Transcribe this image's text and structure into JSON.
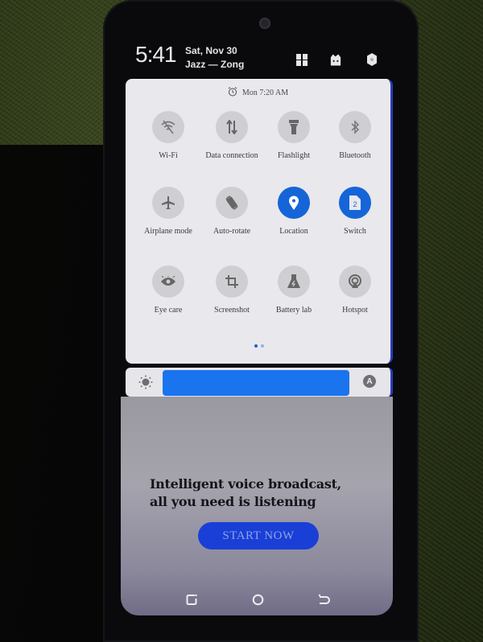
{
  "status_bar": {
    "time": "5:41",
    "date": "Sat, Nov 30",
    "carriers": "Jazz — Zong",
    "icons": [
      "split-screen-icon",
      "theme-icon",
      "settings-icon"
    ]
  },
  "quick_settings": {
    "alarm": {
      "icon": "alarm-clock-icon",
      "label": "Mon 7:20 AM"
    },
    "tiles": [
      {
        "label": "Wi-Fi",
        "icon": "wifi-off-icon",
        "active": false
      },
      {
        "label": "Data connection",
        "icon": "data-arrows-icon",
        "active": false
      },
      {
        "label": "Flashlight",
        "icon": "flashlight-icon",
        "active": false
      },
      {
        "label": "Bluetooth",
        "icon": "bluetooth-icon",
        "active": false
      },
      {
        "label": "Airplane mode",
        "icon": "airplane-icon",
        "active": false
      },
      {
        "label": "Auto-rotate",
        "icon": "auto-rotate-icon",
        "active": false
      },
      {
        "label": "Location",
        "icon": "location-pin-icon",
        "active": true
      },
      {
        "label": "Switch",
        "icon": "sim-card-icon",
        "active": true,
        "badge": "2"
      },
      {
        "label": "Eye care",
        "icon": "eye-care-icon",
        "active": false
      },
      {
        "label": "Screenshot",
        "icon": "crop-icon",
        "active": false
      },
      {
        "label": "Battery lab",
        "icon": "flask-icon",
        "active": false
      },
      {
        "label": "Hotspot",
        "icon": "hotspot-icon",
        "active": false
      }
    ],
    "page_indicator": {
      "current": 1,
      "total": 2
    },
    "colors": {
      "active": "#1565d8",
      "inactive": "#cfcfd3"
    }
  },
  "brightness": {
    "level": 0.92,
    "auto_label": "A",
    "color": "#1a74ee"
  },
  "promo": {
    "line1": "Intelligent voice broadcast,",
    "line2": "all you need is listening",
    "button": "START NOW",
    "button_color": "#1a3fd6"
  },
  "nav_bar": {
    "recents": "recents-icon",
    "home": "home-icon",
    "back": "back-icon"
  }
}
